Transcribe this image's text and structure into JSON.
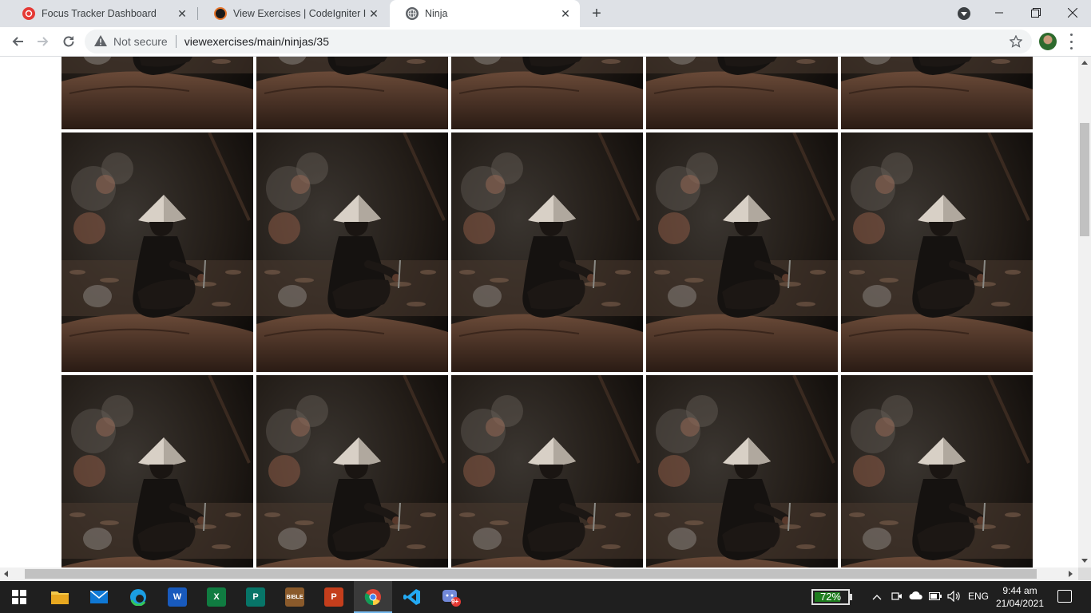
{
  "browser": {
    "tabs": [
      {
        "title": "Focus Tracker Dashboard",
        "favicon": "focus-tracker-icon",
        "active": false
      },
      {
        "title": "View Exercises | CodeIgniter I",
        "favicon": "codeigniter-icon",
        "active": false
      },
      {
        "title": "Ninja",
        "favicon": "globe-icon",
        "active": true
      }
    ],
    "address_bar": {
      "security_label": "Not secure",
      "url": "viewexercises/main/ninjas/35"
    }
  },
  "page": {
    "image_subject": "ninja-photo",
    "columns": 5,
    "visible_rows": 3
  },
  "taskbar": {
    "battery_percent": "72%",
    "battery_level": 0.72,
    "language": "ENG",
    "time": "9:44 am",
    "date": "21/04/2021",
    "apps": [
      "start-icon",
      "file-explorer-icon",
      "mail-icon",
      "edge-icon",
      "word-icon",
      "excel-icon",
      "publisher-icon",
      "bible-app-icon",
      "powerpoint-icon",
      "chrome-icon",
      "vscode-icon",
      "discord-icon"
    ],
    "discord_badge": "9+"
  },
  "colors": {
    "tabstrip": "#dee1e6",
    "taskbar": "#1f1f1f",
    "active_indicator": "#76b9ed"
  }
}
